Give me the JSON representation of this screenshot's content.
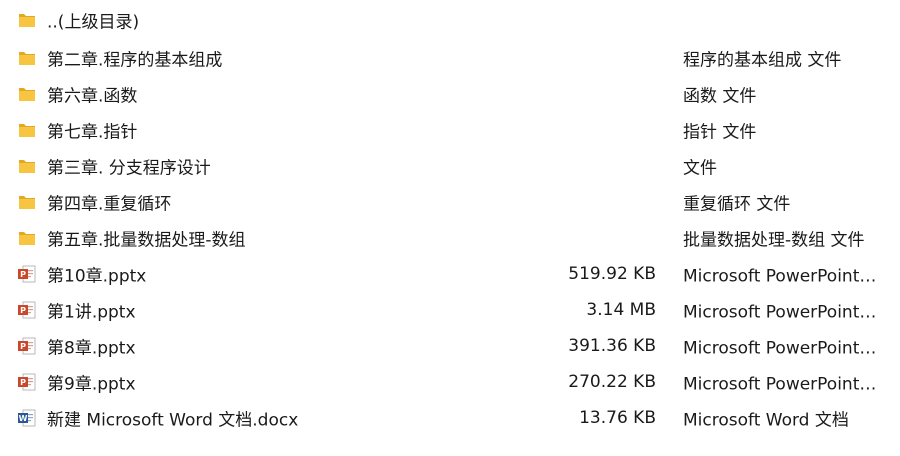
{
  "files": [
    {
      "name": "..(上级目录)",
      "size": "",
      "type": "",
      "icon": "folder-icon"
    },
    {
      "name": "第二章.程序的基本组成",
      "size": "",
      "type": "程序的基本组成 文件",
      "icon": "folder-icon"
    },
    {
      "name": "第六章.函数",
      "size": "",
      "type": "函数 文件",
      "icon": "folder-icon"
    },
    {
      "name": "第七章.指针",
      "size": "",
      "type": "指针 文件",
      "icon": "folder-icon"
    },
    {
      "name": "第三章. 分支程序设计",
      "size": "",
      "type": "文件",
      "icon": "folder-icon"
    },
    {
      "name": "第四章.重复循环",
      "size": "",
      "type": "重复循环 文件",
      "icon": "folder-icon"
    },
    {
      "name": "第五章.批量数据处理-数组",
      "size": "",
      "type": "批量数据处理-数组 文件",
      "icon": "folder-icon"
    },
    {
      "name": "第10章.pptx",
      "size": "519.92 KB",
      "type": "Microsoft PowerPoint 演示文稿",
      "icon": "powerpoint-file-icon"
    },
    {
      "name": "第1讲.pptx",
      "size": "3.14 MB",
      "type": "Microsoft PowerPoint 演示文稿",
      "icon": "powerpoint-file-icon"
    },
    {
      "name": "第8章.pptx",
      "size": "391.36 KB",
      "type": "Microsoft PowerPoint 演示文稿",
      "icon": "powerpoint-file-icon"
    },
    {
      "name": "第9章.pptx",
      "size": "270.22 KB",
      "type": "Microsoft PowerPoint 演示文稿",
      "icon": "powerpoint-file-icon"
    },
    {
      "name": "新建 Microsoft Word 文档.docx",
      "size": "13.76 KB",
      "type": "Microsoft Word 文档",
      "icon": "word-file-icon"
    }
  ],
  "colors": {
    "folder": "#f7c542",
    "folder_dark": "#e2a923",
    "powerpoint": "#c9472b",
    "word": "#2b5797",
    "text": "#1a1a1a"
  }
}
